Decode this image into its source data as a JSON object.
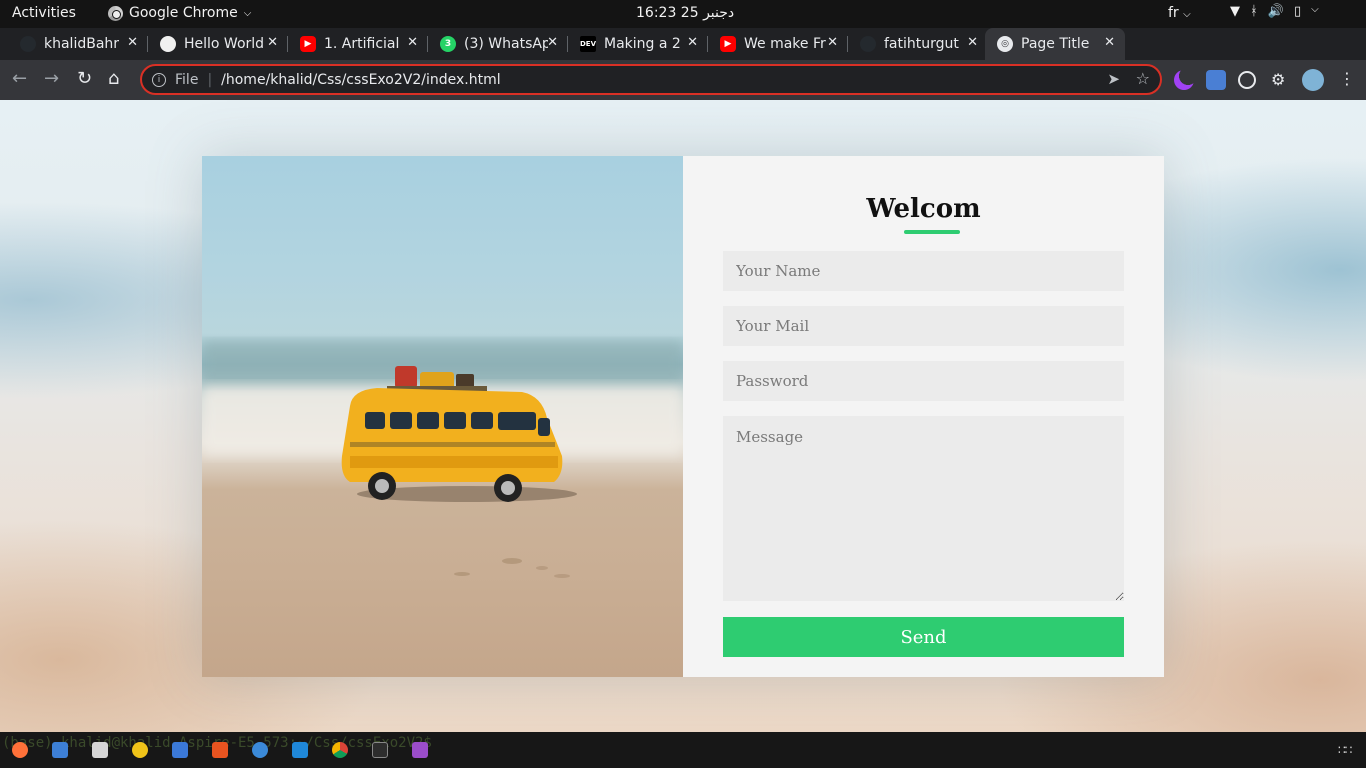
{
  "topbar": {
    "activities": "Activities",
    "app_name": "Google Chrome",
    "clock": "16:23  25 دجنبر",
    "lang": "fr"
  },
  "tabs": [
    {
      "title": "khalidBahr",
      "favicon": "github-icon",
      "color": "#24292e",
      "active": false
    },
    {
      "title": "Hello World",
      "favicon": "github-icon",
      "color": "#24292e",
      "active": false
    },
    {
      "title": "1. Artificial",
      "favicon": "youtube-icon",
      "color": "#ff0000",
      "active": false
    },
    {
      "title": "(3) WhatsApp",
      "favicon": "whatsapp-icon",
      "color": "#25d366",
      "active": false
    },
    {
      "title": "Making a 2",
      "favicon": "dev-icon",
      "color": "#000000",
      "active": false
    },
    {
      "title": "We make Fr",
      "favicon": "youtube-icon",
      "color": "#ff0000",
      "active": false
    },
    {
      "title": "fatihturgut",
      "favicon": "github-icon",
      "color": "#24292e",
      "active": false
    },
    {
      "title": "Page Title",
      "favicon": "globe-icon",
      "color": "#e8eaed",
      "active": true
    }
  ],
  "omnibox": {
    "scheme": "File",
    "url": "/home/khalid/Css/cssExo2V2/index.html"
  },
  "page": {
    "form_title": "Welcom",
    "accent": "#2ecc71",
    "name_placeholder": "Your Name",
    "mail_placeholder": "Your Mail",
    "password_placeholder": "Password",
    "message_placeholder": "Message",
    "send_label": "Send"
  },
  "taskbar": {
    "terminal_prompt": "(base) khalid@khalid-Aspire-E5-573:~/Css/cssExo2V2$"
  }
}
